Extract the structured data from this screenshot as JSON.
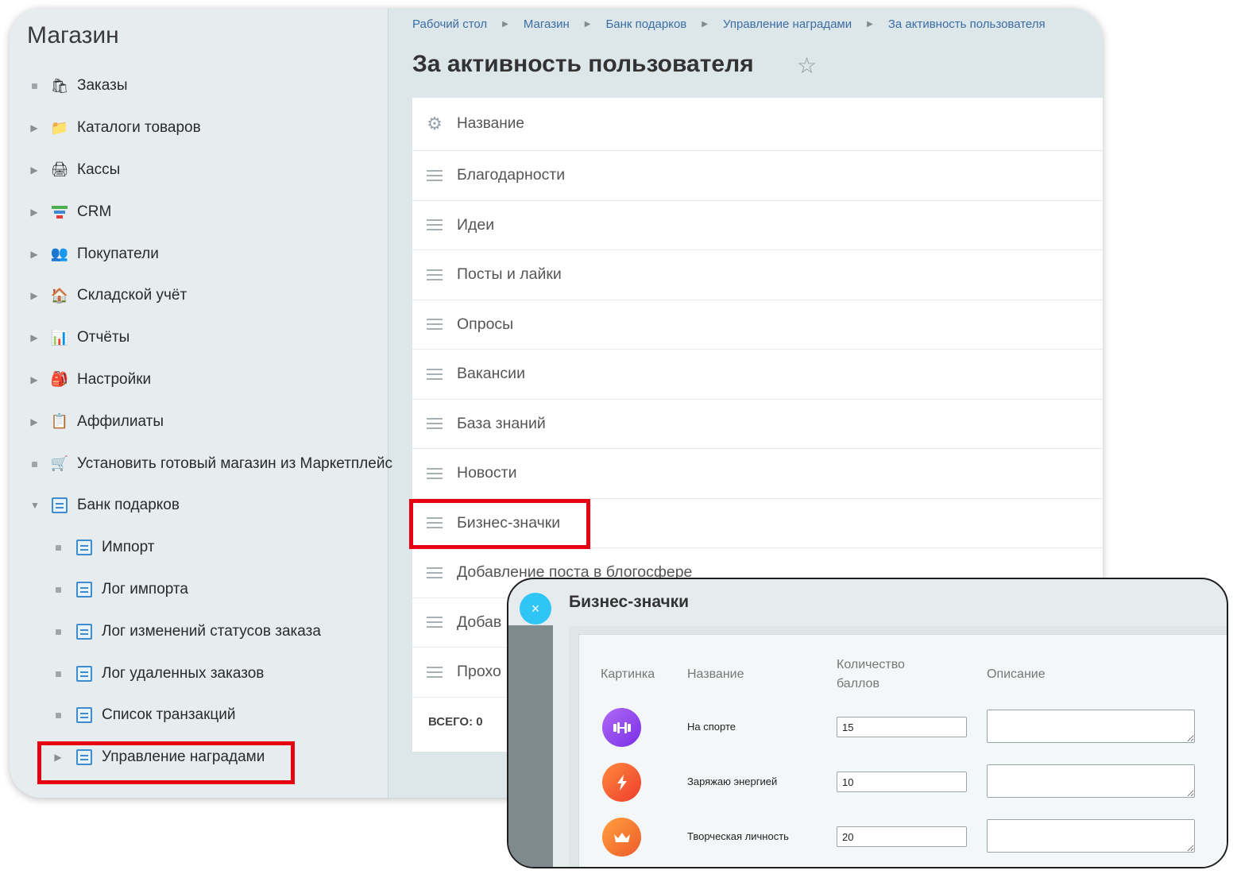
{
  "sidebar": {
    "title": "Магазин",
    "items": [
      {
        "label": "Заказы",
        "icon": "shopping-bag-icon"
      },
      {
        "label": "Каталоги товаров",
        "icon": "folder-icon"
      },
      {
        "label": "Кассы",
        "icon": "cash-register-icon"
      },
      {
        "label": "CRM",
        "icon": "funnel-icon"
      },
      {
        "label": "Покупатели",
        "icon": "users-icon"
      },
      {
        "label": "Складской учёт",
        "icon": "warehouse-icon"
      },
      {
        "label": "Отчёты",
        "icon": "chart-icon"
      },
      {
        "label": "Настройки",
        "icon": "settings-bag-icon"
      },
      {
        "label": "Аффилиаты",
        "icon": "affiliates-icon"
      },
      {
        "label": "Установить готовый магазин из Маркетплейс",
        "icon": "cart-icon"
      },
      {
        "label": "Банк подарков",
        "icon": "document-icon"
      }
    ],
    "subitems": [
      {
        "label": "Импорт"
      },
      {
        "label": "Лог импорта"
      },
      {
        "label": "Лог изменений статусов заказа"
      },
      {
        "label": "Лог удаленных заказов"
      },
      {
        "label": "Список транзакций"
      },
      {
        "label": "Управление наградами"
      }
    ]
  },
  "breadcrumb": [
    "Рабочий стол",
    "Магазин",
    "Банк подарков",
    "Управление наградами",
    "За активность пользователя"
  ],
  "page_title": "За активность пользователя",
  "list": {
    "header": "Название",
    "rows": [
      "Благодарности",
      "Идеи",
      "Посты и лайки",
      "Опросы",
      "Вакансии",
      "База знаний",
      "Новости",
      "Бизнес-значки",
      "Добавление поста в блогосфере",
      "Добав",
      "Прохо"
    ],
    "total_label": "ВСЕГО:",
    "total_value": "0"
  },
  "popup": {
    "title": "Бизнес-значки",
    "close_symbol": "×",
    "headers": {
      "picture": "Картинка",
      "name": "Название",
      "points_line1": "Количество",
      "points_line2": "баллов",
      "description": "Описание"
    },
    "rows": [
      {
        "name": "На спорте",
        "points": "15",
        "icon": "dumbbell-icon",
        "color": "#8e44ec"
      },
      {
        "name": "Заряжаю энергией",
        "points": "10",
        "icon": "lightning-icon",
        "color": "#f0522c"
      },
      {
        "name": "Творческая личность",
        "points": "20",
        "icon": "crown-icon",
        "color": "#f06a2c"
      }
    ]
  },
  "colors": {
    "highlight": "#e60012",
    "link": "#3b6ea5",
    "close": "#2fc6f6"
  }
}
